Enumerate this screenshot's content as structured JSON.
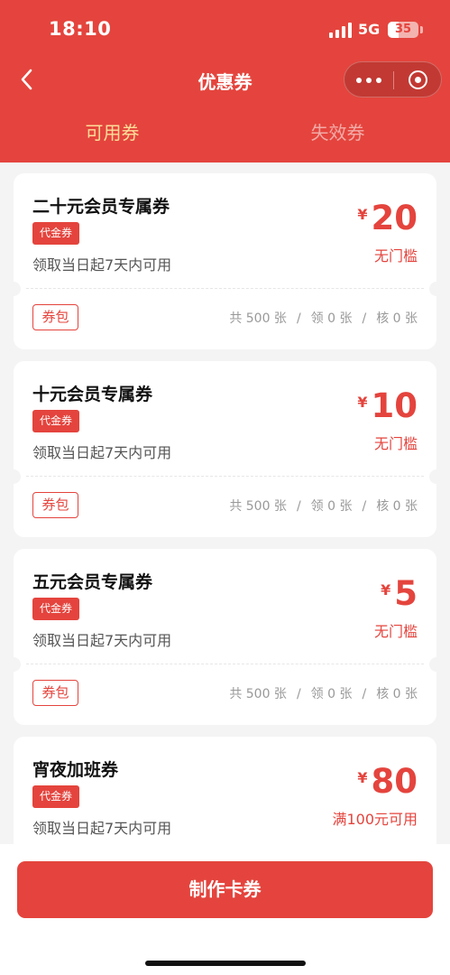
{
  "status_bar": {
    "time": "18:10",
    "network": "5G",
    "battery": "35",
    "battery_level": 0.35
  },
  "nav": {
    "title": "优惠券",
    "back_icon": "chevron-left-icon",
    "more_icon": "more-dots-icon",
    "close_icon": "target-circle-icon"
  },
  "tabs": [
    {
      "label": "可用券",
      "active": true
    },
    {
      "label": "失效券",
      "active": false
    }
  ],
  "coupons": [
    {
      "title": "二十元会员专属券",
      "tag": "代金券",
      "validity": "领取当日起7天内可用",
      "currency": "¥",
      "amount": "20",
      "condition": "无门槛",
      "wallet_label": "券包",
      "total": "共 500 张",
      "claimed": "领 0 张",
      "used": "核 0 张"
    },
    {
      "title": "十元会员专属券",
      "tag": "代金券",
      "validity": "领取当日起7天内可用",
      "currency": "¥",
      "amount": "10",
      "condition": "无门槛",
      "wallet_label": "券包",
      "total": "共 500 张",
      "claimed": "领 0 张",
      "used": "核 0 张"
    },
    {
      "title": "五元会员专属券",
      "tag": "代金券",
      "validity": "领取当日起7天内可用",
      "currency": "¥",
      "amount": "5",
      "condition": "无门槛",
      "wallet_label": "券包",
      "total": "共 500 张",
      "claimed": "领 0 张",
      "used": "核 0 张"
    },
    {
      "title": "宵夜加班券",
      "tag": "代金券",
      "validity": "领取当日起7天内可用",
      "currency": "¥",
      "amount": "80",
      "condition": "满100元可用"
    }
  ],
  "stat_separator": "/",
  "footer": {
    "create_label": "制作卡券"
  },
  "colors": {
    "primary": "#e4443d",
    "tab_active": "#ffdd99",
    "background": "#f4f4f4"
  }
}
